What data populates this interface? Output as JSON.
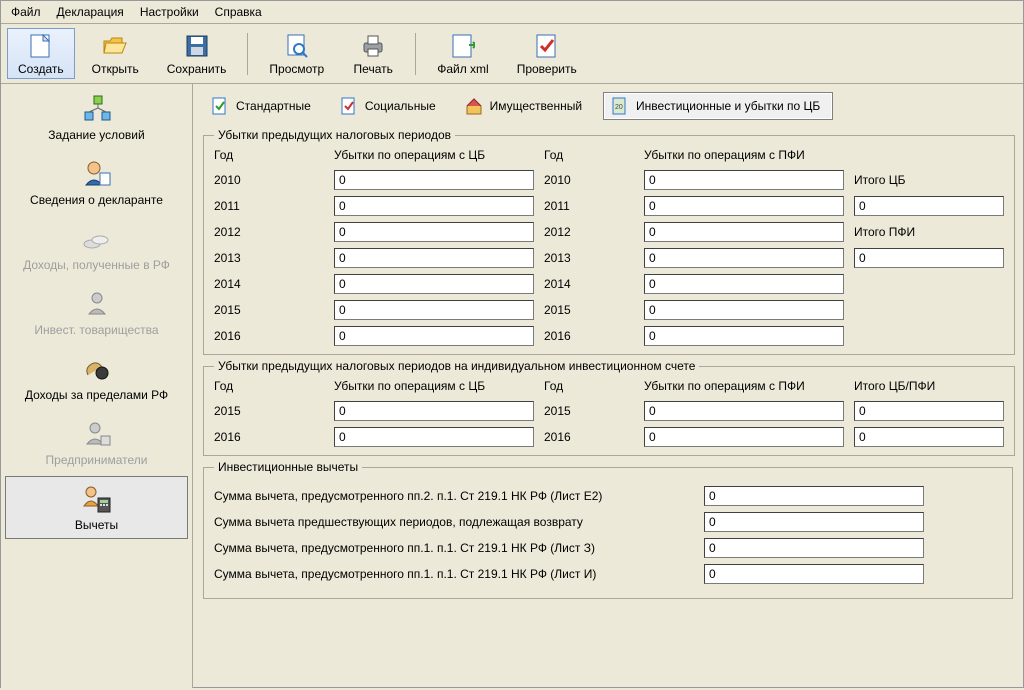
{
  "menubar": {
    "file": "Файл",
    "declaration": "Декларация",
    "settings": "Настройки",
    "help": "Справка"
  },
  "toolbar": {
    "create": "Создать",
    "open": "Открыть",
    "save": "Сохранить",
    "preview": "Просмотр",
    "print": "Печать",
    "xml": "Файл xml",
    "check": "Проверить"
  },
  "sidebar": {
    "conditions": "Задание условий",
    "declarant": "Сведения о декларанте",
    "income_rf": "Доходы, полученные в РФ",
    "invest_partnerships": "Инвест. товарищества",
    "income_abroad": "Доходы за пределами РФ",
    "entrepreneurs": "Предприниматели",
    "deductions": "Вычеты"
  },
  "tabs": {
    "standard": "Стандартные",
    "social": "Социальные",
    "property": "Имущественный",
    "investment": "Инвестиционные и убытки по ЦБ"
  },
  "section1": {
    "title": "Убытки предыдущих налоговых периодов",
    "col_year": "Год",
    "col_losses_cb": "Убытки по операциям с ЦБ",
    "col_year2": "Год",
    "col_losses_pfi": "Убытки по операциям с ПФИ",
    "years": [
      "2010",
      "2011",
      "2012",
      "2013",
      "2014",
      "2015",
      "2016"
    ],
    "cb_values": [
      "0",
      "0",
      "0",
      "0",
      "0",
      "0",
      "0"
    ],
    "pfi_values": [
      "0",
      "0",
      "0",
      "0",
      "0",
      "0",
      "0"
    ],
    "total_cb_label": "Итого ЦБ",
    "total_cb_value": "0",
    "total_pfi_label": "Итого ПФИ",
    "total_pfi_value": "0"
  },
  "section2": {
    "title": "Убытки предыдущих налоговых периодов на индивидуальном инвестиционном счете",
    "col_year": "Год",
    "col_losses_cb": "Убытки по операциям с ЦБ",
    "col_year2": "Год",
    "col_losses_pfi": "Убытки по операциям с ПФИ",
    "col_total": "Итого ЦБ/ПФИ",
    "years": [
      "2015",
      "2016"
    ],
    "cb_values": [
      "0",
      "0"
    ],
    "pfi_values": [
      "0",
      "0"
    ],
    "total_values": [
      "0",
      "0"
    ]
  },
  "section3": {
    "title": "Инвестиционные вычеты",
    "rows": [
      {
        "label": "Сумма вычета, предусмотренного пп.2. п.1. Ст 219.1 НК РФ (Лист Е2)",
        "value": "0"
      },
      {
        "label": "Сумма вычета предшествующих периодов, подлежащая возврату",
        "value": "0"
      },
      {
        "label": "Сумма вычета, предусмотренного пп.1. п.1. Ст 219.1 НК РФ (Лист З)",
        "value": "0"
      },
      {
        "label": "Сумма вычета, предусмотренного пп.1. п.1. Ст 219.1 НК РФ (Лист И)",
        "value": "0"
      }
    ]
  }
}
